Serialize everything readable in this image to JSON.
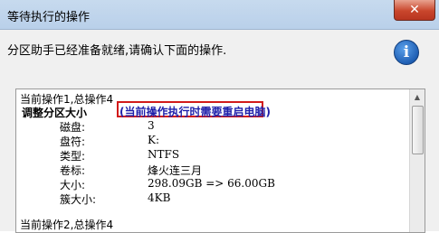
{
  "window": {
    "title": "等待执行的操作",
    "close_glyph": "✕"
  },
  "instruction": "分区助手已经准备就绪,请确认下面的操作.",
  "info_icon": {
    "glyph": "i",
    "name": "info-icon"
  },
  "operations": {
    "op1_header": "当前操作1,总操作4",
    "op1_title": "调整分区大小",
    "op1_notice": "(当前操作执行时需要重启电脑)",
    "details": [
      {
        "label": "磁盘:",
        "value": "3"
      },
      {
        "label": "盘符:",
        "value": "K:"
      },
      {
        "label": "类型:",
        "value": "NTFS"
      },
      {
        "label": "卷标:",
        "value": "烽火连三月"
      },
      {
        "label": "大小:",
        "value": "298.09GB => 66.00GB"
      },
      {
        "label": "簇大小:",
        "value": "4KB"
      }
    ],
    "op2_header": "当前操作2,总操作4"
  },
  "scrollbar": {
    "up_glyph": "▲"
  },
  "colors": {
    "highlight_border": "#d21a1a",
    "notice_text": "#1f1faa"
  }
}
